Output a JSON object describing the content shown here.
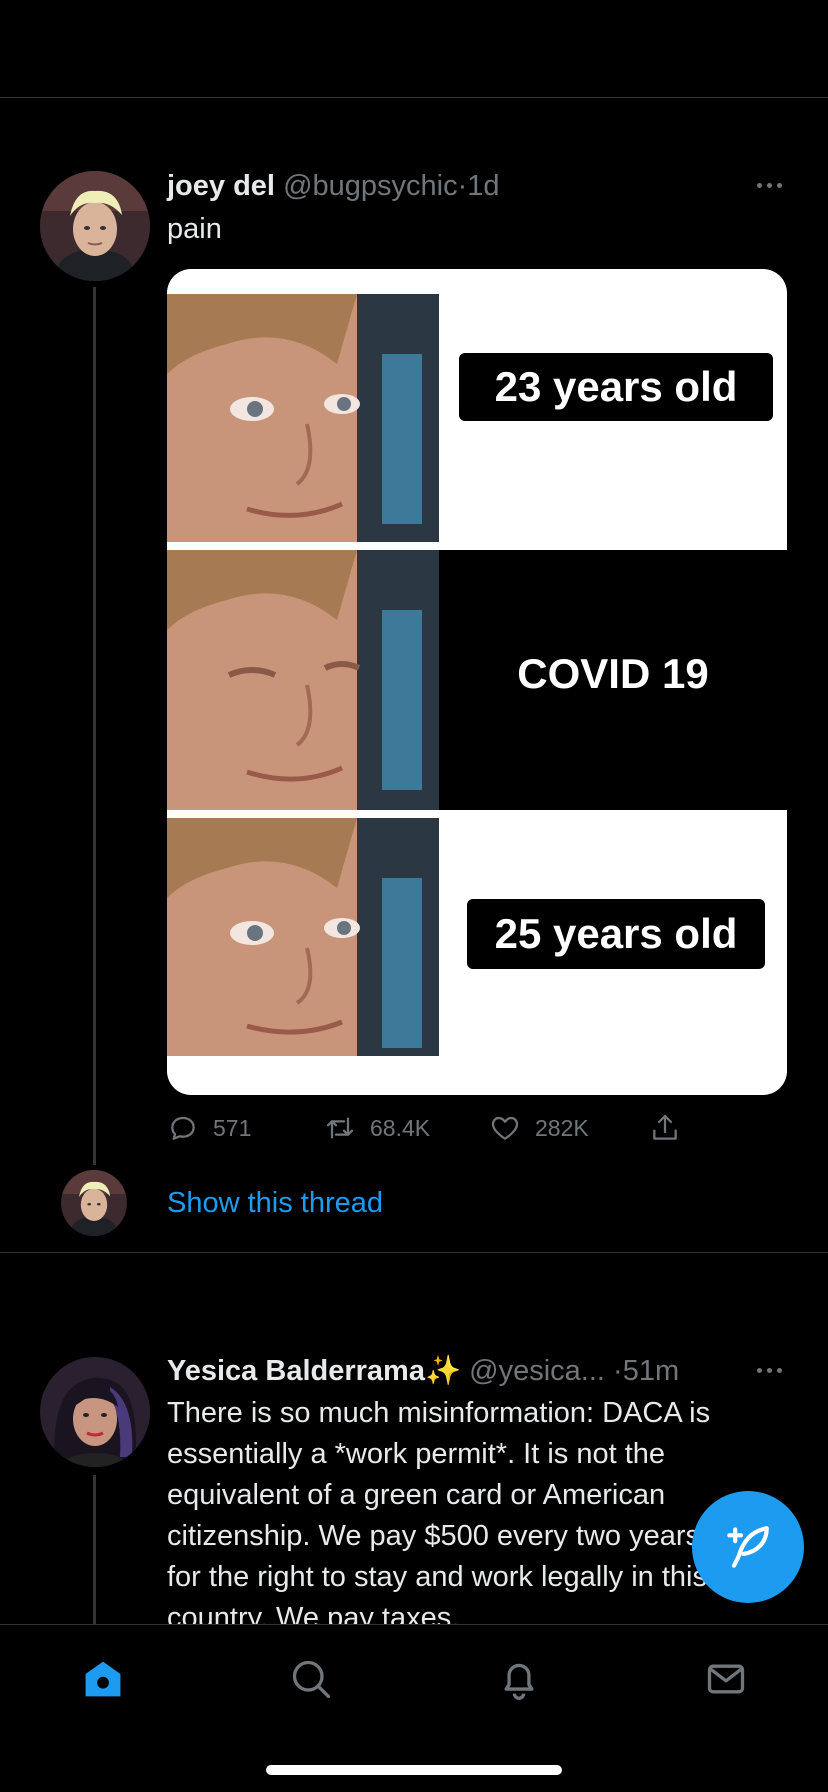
{
  "tweet1": {
    "name": "joey del",
    "handle": "@bugpsychic",
    "separator": "·",
    "time": "1d",
    "text": "pain",
    "media": {
      "panel1_label": "23 years old",
      "panel2_label": "COVID 19",
      "panel3_label": "25 years old"
    },
    "actions": {
      "replies": "571",
      "retweets": "68.4K",
      "likes": "282K"
    },
    "show_thread": "Show this thread"
  },
  "tweet2": {
    "name": "Yesica Balderrama",
    "emoji": "✨",
    "handle": "@yesica...",
    "separator": "·",
    "time": "51m",
    "lines": [
      "There is so much misinformation: DACA is",
      "essentially a *work permit*. It is not the",
      "equivalent of a green card or American",
      "citizenship. We pay $500 every two years",
      "for the right to stay and work legally in this",
      "country. We pay taxes."
    ]
  },
  "colors": {
    "accent": "#1d9bf0",
    "muted": "#71767b",
    "background": "#000000"
  },
  "tabs": [
    {
      "icon": "home-icon",
      "active": true
    },
    {
      "icon": "search-icon",
      "active": false
    },
    {
      "icon": "bell-icon",
      "active": false
    },
    {
      "icon": "mail-icon",
      "active": false
    }
  ]
}
